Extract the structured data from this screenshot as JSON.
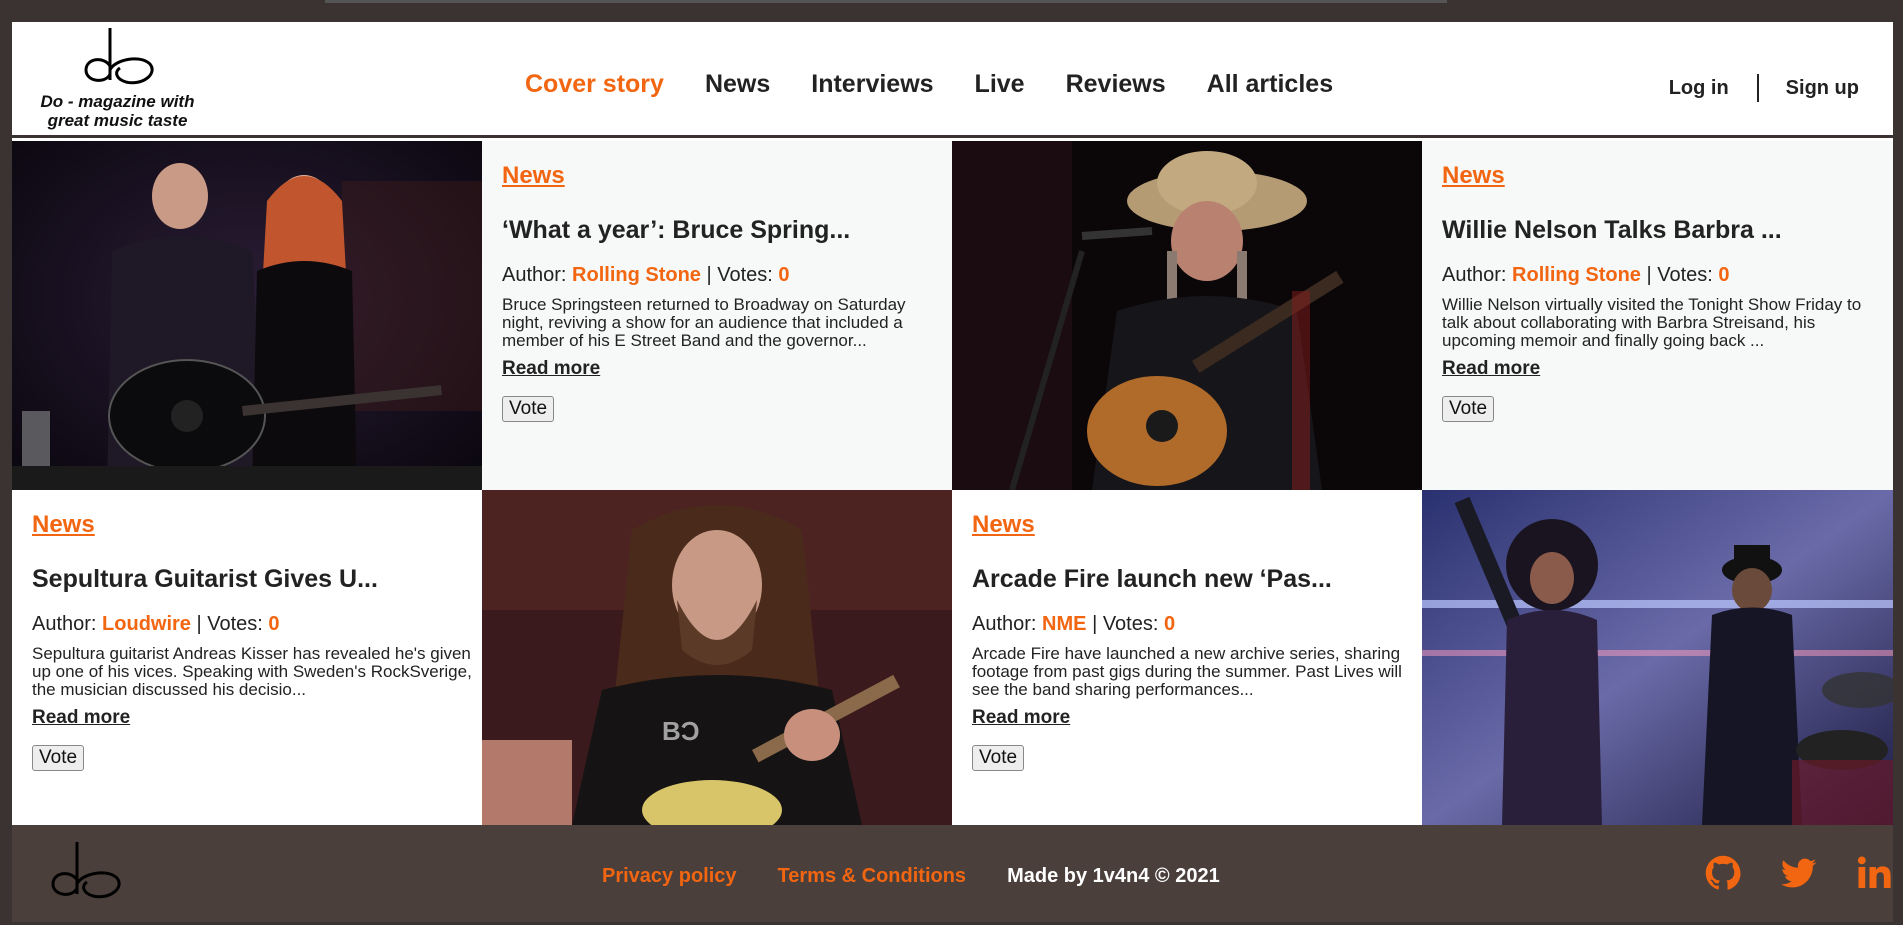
{
  "brand": {
    "tagline": "Do - magazine with great music taste",
    "accent": "#f26511",
    "dark": "#3b3331"
  },
  "nav": {
    "items": [
      "Cover story",
      "News",
      "Interviews",
      "Live",
      "Reviews",
      "All articles"
    ],
    "active": "Cover story"
  },
  "auth": {
    "login": "Log in",
    "signup": "Sign up"
  },
  "articles": [
    {
      "category": "News",
      "title": "‘What a year’: Bruce Spring...",
      "author_label": "Author:",
      "author": "Rolling Stone",
      "votes_label": "| Votes:",
      "votes": "0",
      "excerpt": "Bruce Springsteen returned to Broadway on Saturday night, reviving a show for an audience that included a member of his E Street Band and the governor...",
      "read_more": "Read more",
      "vote": "Vote"
    },
    {
      "category": "News",
      "title": "Willie Nelson Talks Barbra ...",
      "author_label": "Author:",
      "author": "Rolling Stone",
      "votes_label": "| Votes:",
      "votes": "0",
      "excerpt": "Willie Nelson virtually visited the Tonight Show Friday to talk about collaborating with Barbra Streisand, his upcoming memoir and finally going back ...",
      "read_more": "Read more",
      "vote": "Vote"
    },
    {
      "category": "News",
      "title": "Sepultura Guitarist Gives U...",
      "author_label": "Author:",
      "author": "Loudwire",
      "votes_label": "| Votes:",
      "votes": "0",
      "excerpt": "Sepultura guitarist Andreas Kisser has revealed he's given up one of his vices. Speaking with Sweden's RockSverige, the musician discussed his decisio...",
      "read_more": "Read more",
      "vote": "Vote"
    },
    {
      "category": "News",
      "title": "Arcade Fire launch new ‘Pas...",
      "author_label": "Author:",
      "author": "NME",
      "votes_label": "| Votes:",
      "votes": "0",
      "excerpt": "Arcade Fire have launched a new archive series, sharing footage from past gigs during the summer. Past Lives will see the band sharing performances...",
      "read_more": "Read more",
      "vote": "Vote"
    }
  ],
  "footer": {
    "privacy": "Privacy policy",
    "terms": "Terms & Conditions",
    "credit": "Made by 1v4n4 © 2021",
    "social_icons": [
      "github-icon",
      "twitter-icon",
      "linkedin-icon"
    ]
  }
}
